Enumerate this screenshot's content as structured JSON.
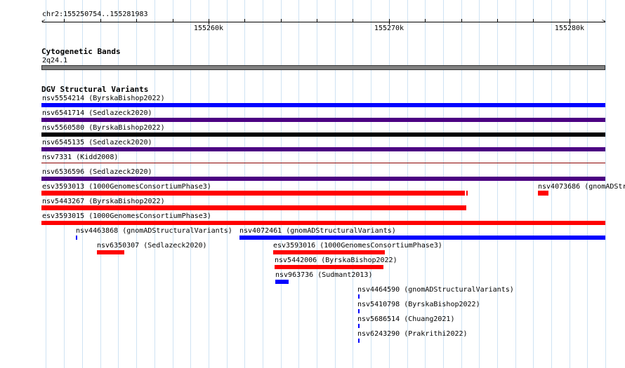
{
  "ruler": {
    "location": "chr2:155250754..155281983",
    "ticks": [
      "155260k",
      "155270k",
      "155280k"
    ]
  },
  "cyto_track": {
    "title": "Cytogenetic Bands",
    "band": "2q24.1",
    "band_color": "#808080"
  },
  "dgv_track": {
    "title": "DGV Structural Variants",
    "features": [
      {
        "name": "nsv5554214 (ByrskaBishop2022)",
        "color": "#0000ff"
      },
      {
        "name": "nsv6541714 (Sedlazeck2020)",
        "color": "#4b0082"
      },
      {
        "name": "nsv5560580 (ByrskaBishop2022)",
        "color": "#000000"
      },
      {
        "name": "nsv6545135 (Sedlazeck2020)",
        "color": "#4b0082"
      },
      {
        "name": "nsv7331 (Kidd2008)",
        "color": "#8b0000"
      },
      {
        "name": "nsv6536596 (Sedlazeck2020)",
        "color": "#4b0082"
      },
      {
        "name": "esv3593013 (1000GenomesConsortiumPhase3)",
        "color": "#ff0000"
      },
      {
        "name": "nsv4073686 (gnomADStr",
        "color": "#ff0000"
      },
      {
        "name": "nsv5443267 (ByrskaBishop2022)",
        "color": "#ff0000"
      },
      {
        "name": "esv3593015 (1000GenomesConsortiumPhase3)",
        "color": "#ff0000"
      },
      {
        "name": "nsv4463868 (gnomADStructuralVariants)",
        "color": "#0000ff"
      },
      {
        "name": "nsv4072461 (gnomADStructuralVariants)",
        "color": "#0000ff"
      },
      {
        "name": "nsv6350307 (Sedlazeck2020)",
        "color": "#ff0000"
      },
      {
        "name": "esv3593016 (1000GenomesConsortiumPhase3)",
        "color": "#ff0000"
      },
      {
        "name": "nsv5442006 (ByrskaBishop2022)",
        "color": "#ff0000"
      },
      {
        "name": "nsv963736 (Sudmant2013)",
        "color": "#0000ff"
      },
      {
        "name": "nsv4464590 (gnomADStructuralVariants)",
        "color": "#0000ff"
      },
      {
        "name": "nsv5410798 (ByrskaBishop2022)",
        "color": "#0000ff"
      },
      {
        "name": "nsv5686514 (Chuang2021)",
        "color": "#0000ff"
      },
      {
        "name": "nsv6243290 (Prakrithi2022)",
        "color": "#0000ff"
      }
    ]
  }
}
